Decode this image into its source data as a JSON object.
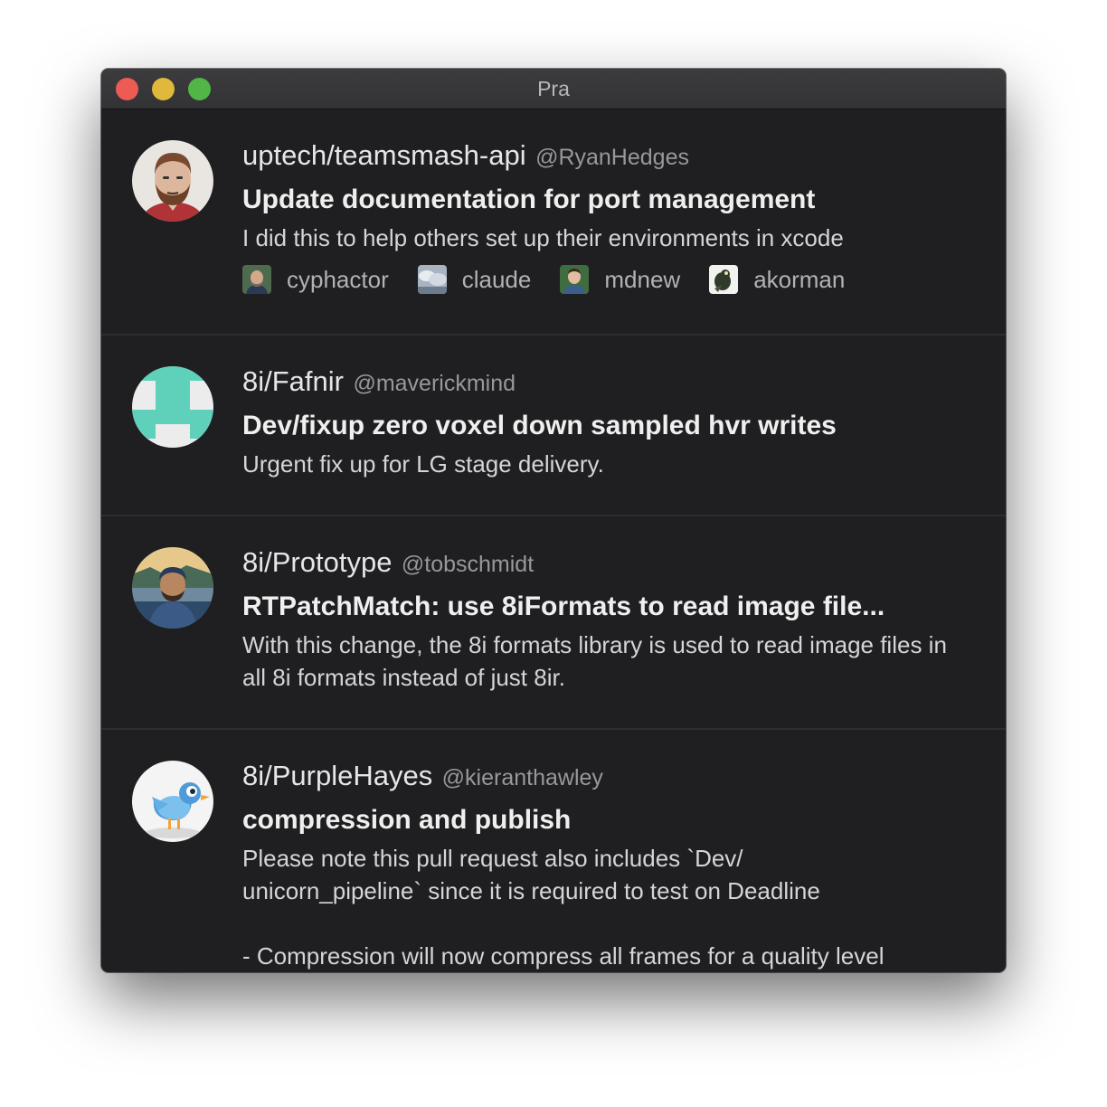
{
  "window": {
    "title": "Pra"
  },
  "pull_requests": [
    {
      "repo": "uptech/teamsmash-api",
      "author": "@RyanHedges",
      "title": "Update documentation for port management",
      "body": "I did this to help others set up their environments in xcode",
      "avatar_icon": "bearded-man-avatar-icon",
      "reviewers": [
        {
          "name": "cyphactor",
          "avatar_icon": "man-portrait-avatar-icon"
        },
        {
          "name": "claude",
          "avatar_icon": "cloud-landscape-avatar-icon"
        },
        {
          "name": "mdnew",
          "avatar_icon": "man-green-background-avatar-icon"
        },
        {
          "name": "akorman",
          "avatar_icon": "bird-drawing-avatar-icon"
        }
      ]
    },
    {
      "repo": "8i/Fafnir",
      "author": "@maverickmind",
      "title": "Dev/fixup zero voxel down sampled hvr writes",
      "body": "Urgent fix up for LG stage delivery.",
      "avatar_icon": "teal-identicon-avatar-icon",
      "reviewers": []
    },
    {
      "repo": "8i/Prototype",
      "author": "@tobschmidt",
      "title": "RTPatchMatch: use 8iFormats to read image file...",
      "body": "With this change, the 8i formats library is used to read image files in all 8i formats instead of just 8ir.",
      "avatar_icon": "painted-portrait-avatar-icon",
      "reviewers": []
    },
    {
      "repo": "8i/PurpleHayes",
      "author": "@kieranthawley",
      "title": "compression and publish",
      "body": "Please note this pull request also includes `Dev/\nunicorn_pipeline` since it is required to test on Deadline\n\n- Compression will now compress all frames for a quality level",
      "avatar_icon": "blue-bird-avatar-icon",
      "reviewers": []
    }
  ],
  "colors": {
    "window_bg": "#1f1f21",
    "titlebar": "#363638",
    "close": "#ec5b54",
    "minimize": "#e0b83c",
    "maximize": "#52b646"
  }
}
